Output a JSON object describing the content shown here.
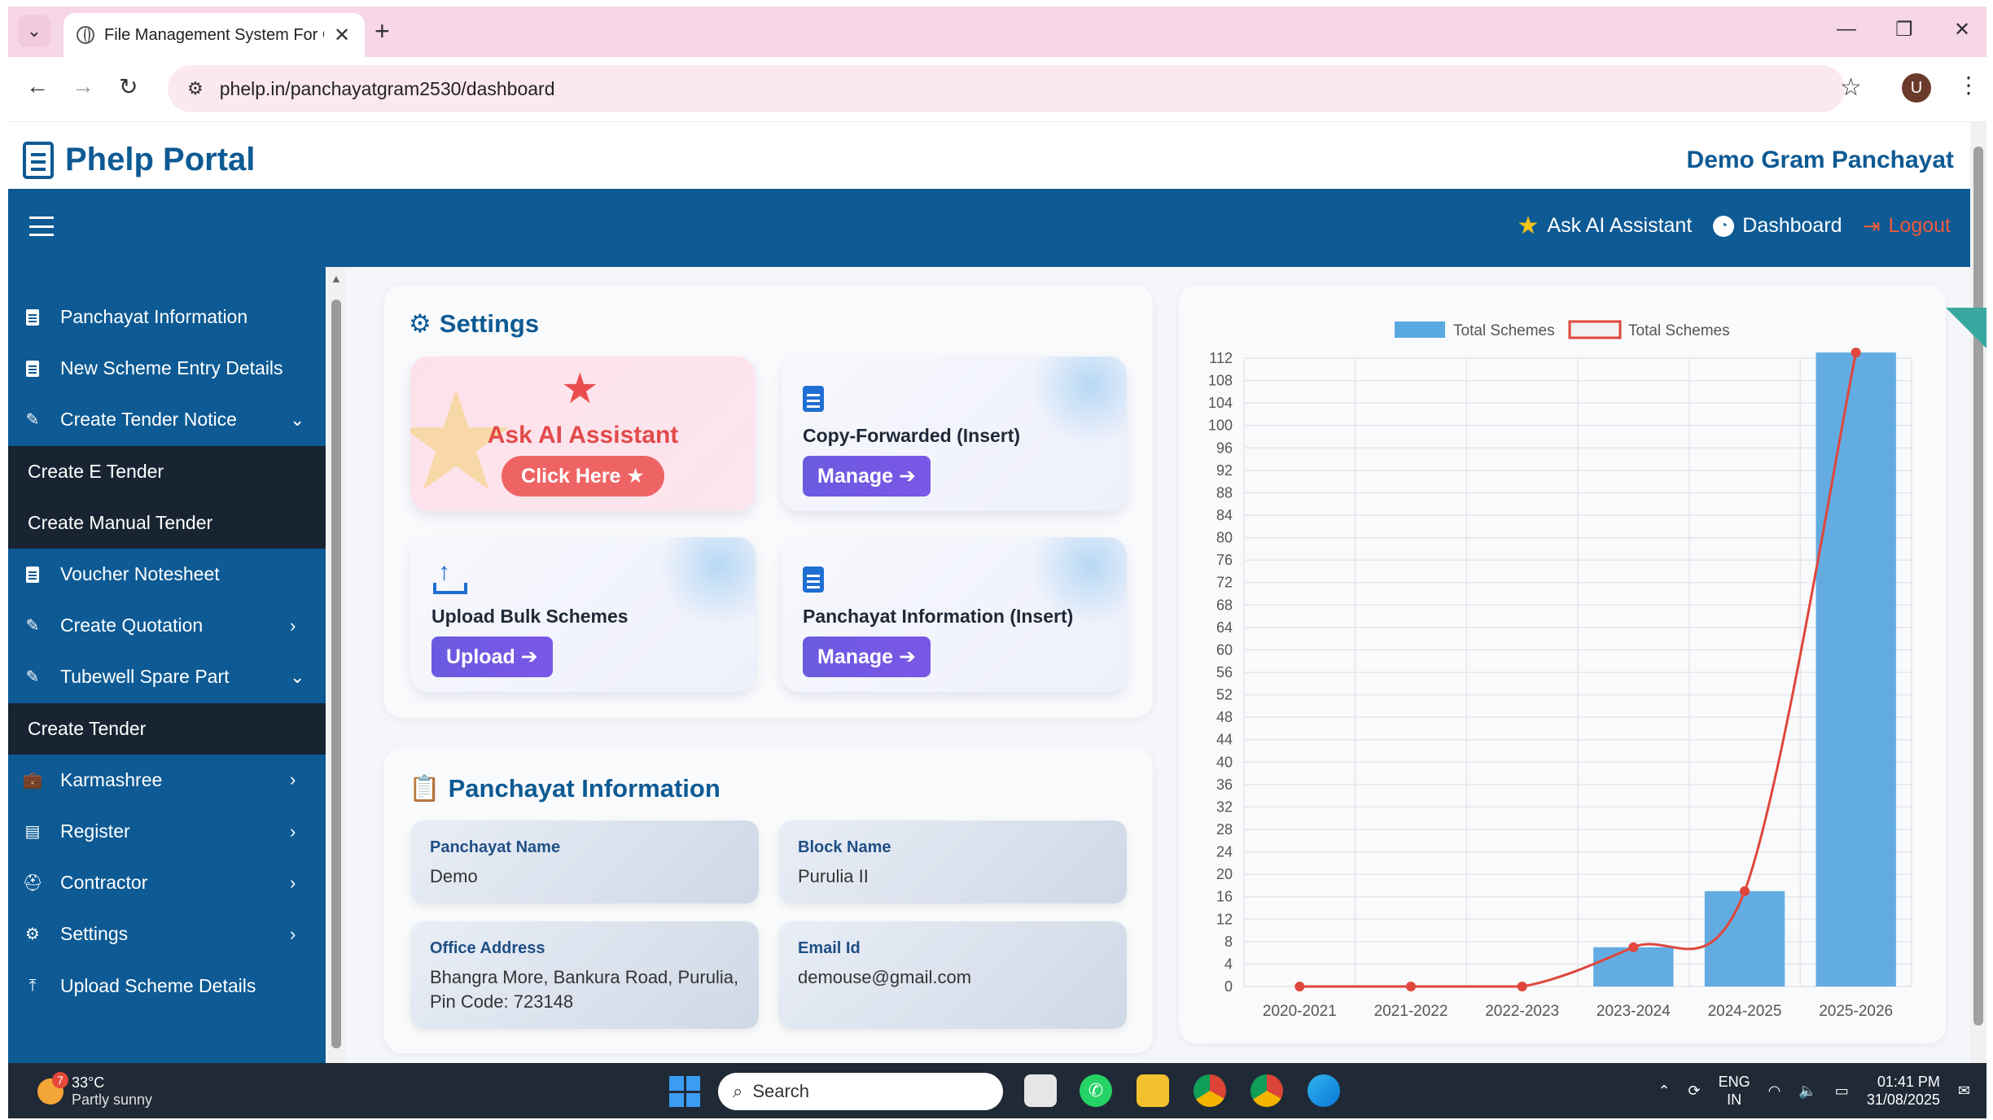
{
  "browser": {
    "tab_title": "File Management System For G",
    "url": "phelp.in/panchayatgram2530/dashboard",
    "profile_initial": "U"
  },
  "header": {
    "brand": "Phelp Portal",
    "panchayat_name": "Demo Gram Panchayat"
  },
  "navbar": {
    "ai_assistant": "Ask AI Assistant",
    "dashboard": "Dashboard",
    "logout": "Logout"
  },
  "sidebar": {
    "items": [
      {
        "label": "Panchayat Information",
        "icon": "document-icon",
        "sub": false
      },
      {
        "label": "New Scheme Entry Details",
        "icon": "document-icon",
        "sub": false
      },
      {
        "label": "Create Tender Notice",
        "icon": "edit-icon",
        "sub": false,
        "chevron": "⌄"
      },
      {
        "label": "Create E Tender",
        "sub": true
      },
      {
        "label": "Create Manual Tender",
        "sub": true
      },
      {
        "label": "Voucher Notesheet",
        "icon": "document-icon",
        "sub": false
      },
      {
        "label": "Create Quotation",
        "icon": "edit-icon",
        "sub": false,
        "chevron": "›"
      },
      {
        "label": "Tubewell Spare Part",
        "icon": "edit-icon",
        "sub": false,
        "chevron": "⌄"
      },
      {
        "label": "Create Tender",
        "sub": true
      },
      {
        "label": "Karmashree",
        "icon": "briefcase-icon",
        "sub": false,
        "chevron": "›"
      },
      {
        "label": "Register",
        "icon": "book-icon",
        "sub": false,
        "chevron": "›"
      },
      {
        "label": "Contractor",
        "icon": "hardhat-icon",
        "sub": false,
        "chevron": "›"
      },
      {
        "label": "Settings",
        "icon": "gear-icon",
        "sub": false,
        "chevron": "›"
      },
      {
        "label": "Upload Scheme Details",
        "icon": "upload-icon",
        "sub": false
      }
    ]
  },
  "settings": {
    "title": "Settings",
    "ai_tile": {
      "title": "Ask AI Assistant",
      "button": "Click Here ★"
    },
    "copy_tile": {
      "title": "Copy-Forwarded (Insert)",
      "button": "Manage ➔"
    },
    "upload_tile": {
      "title": "Upload Bulk Schemes",
      "button": "Upload ➔"
    },
    "pinfo_tile": {
      "title": "Panchayat Information (Insert)",
      "button": "Manage ➔"
    }
  },
  "panchayat_info": {
    "title": "Panchayat Information",
    "fields": [
      {
        "label": "Panchayat Name",
        "value": "Demo"
      },
      {
        "label": "Block Name",
        "value": "Purulia II"
      },
      {
        "label": "Office Address",
        "value": "Bhangra More, Bankura Road, Purulia, Pin Code: 723148"
      },
      {
        "label": "Email Id",
        "value": "demouse@gmail.com"
      }
    ]
  },
  "chart_data": {
    "type": "bar",
    "categories": [
      "2020-2021",
      "2021-2022",
      "2022-2023",
      "2023-2024",
      "2024-2025",
      "2025-2026"
    ],
    "series": [
      {
        "name": "Total Schemes",
        "kind": "bar",
        "color": "#5aa8e0",
        "values": [
          0,
          0,
          0,
          7,
          17,
          113
        ]
      },
      {
        "name": "Total Schemes",
        "kind": "line",
        "color": "#e0463b",
        "values": [
          0,
          0,
          0,
          7,
          17,
          113
        ]
      }
    ],
    "yticks": [
      0,
      4,
      8,
      12,
      16,
      20,
      24,
      28,
      32,
      36,
      40,
      44,
      48,
      52,
      56,
      60,
      64,
      68,
      72,
      76,
      80,
      84,
      88,
      92,
      96,
      100,
      104,
      108,
      112
    ],
    "ylim": [
      0,
      112
    ],
    "grid": true,
    "legend_position": "top"
  },
  "taskbar": {
    "weather_temp": "33°C",
    "weather_desc": "Partly sunny",
    "weather_badge": "7",
    "search": "Search",
    "lang1": "ENG",
    "lang2": "IN",
    "time": "01:41 PM",
    "date": "31/08/2025"
  }
}
